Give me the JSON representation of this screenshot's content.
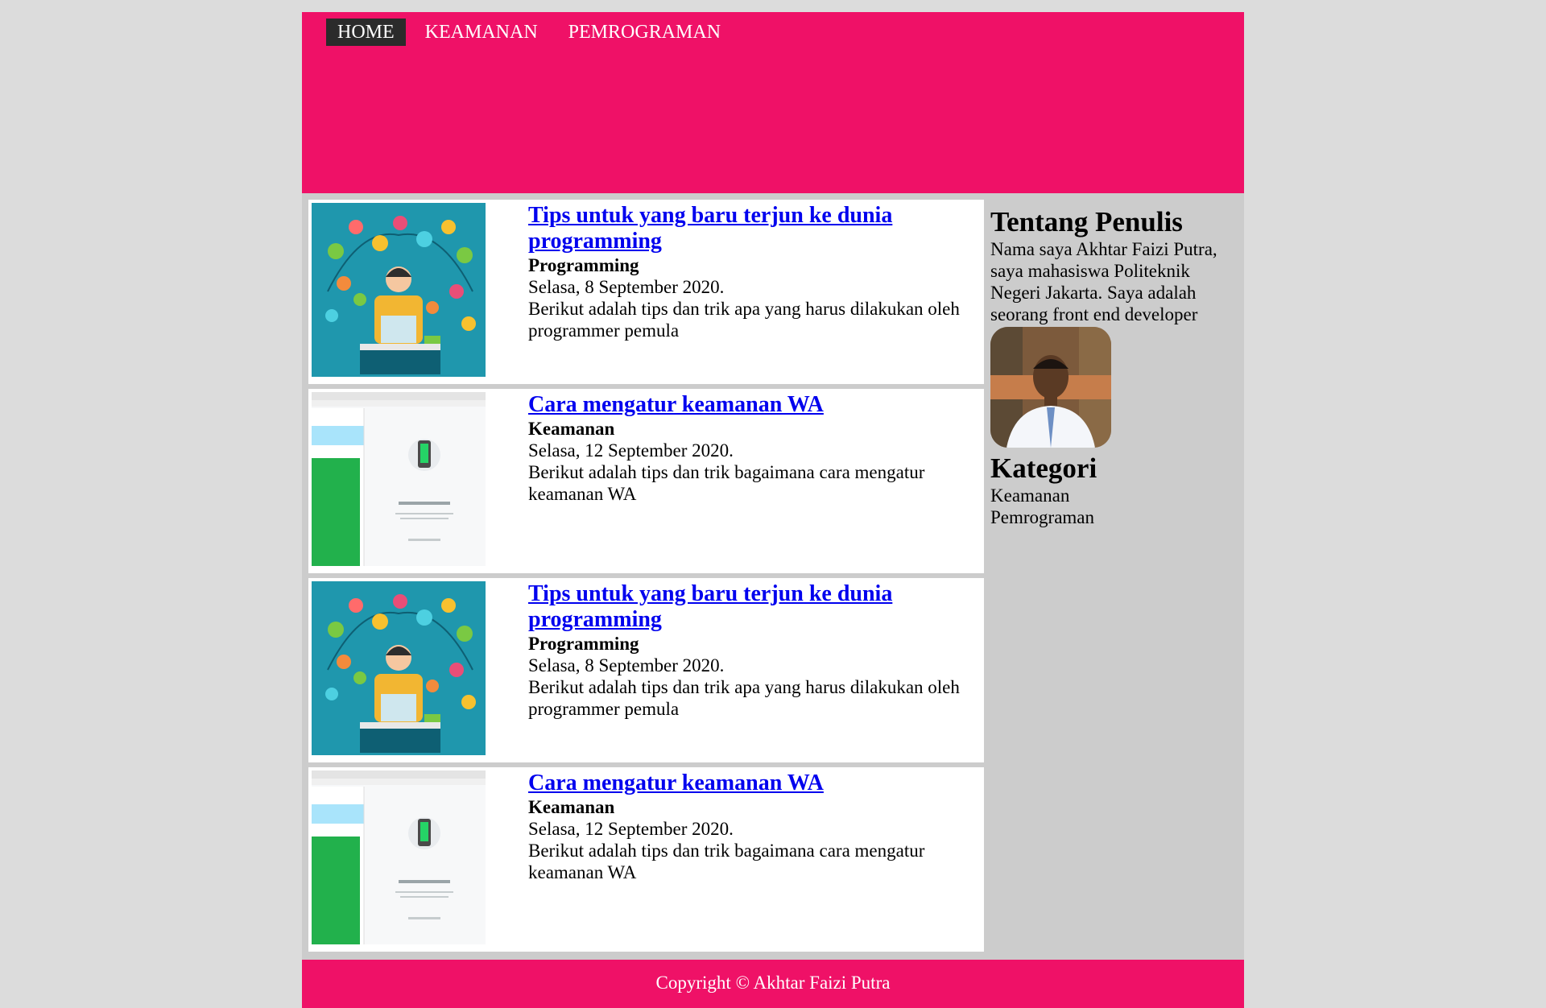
{
  "nav": {
    "items": [
      {
        "label": "HOME"
      },
      {
        "label": "KEAMANAN"
      },
      {
        "label": "PEMROGRAMAN"
      }
    ]
  },
  "posts": [
    {
      "title": "Tips untuk yang baru terjun ke dunia programming",
      "category": "Programming",
      "date": "Selasa, 8 September 2020.",
      "desc": "Berikut adalah tips dan trik apa yang harus dilakukan oleh programmer pemula",
      "thumb": "programming-illustration"
    },
    {
      "title": "Cara mengatur keamanan WA",
      "category": "Keamanan",
      "date": "Selasa, 12 September 2020.",
      "desc": "Berikut adalah tips dan trik bagaimana cara mengatur keamanan WA",
      "thumb": "whatsapp-web-screenshot"
    },
    {
      "title": "Tips untuk yang baru terjun ke dunia programming",
      "category": "Programming",
      "date": "Selasa, 8 September 2020.",
      "desc": "Berikut adalah tips dan trik apa yang harus dilakukan oleh programmer pemula",
      "thumb": "programming-illustration"
    },
    {
      "title": "Cara mengatur keamanan WA",
      "category": "Keamanan",
      "date": "Selasa, 12 September 2020.",
      "desc": "Berikut adalah tips dan trik bagaimana cara mengatur keamanan WA",
      "thumb": "whatsapp-web-screenshot"
    }
  ],
  "aside": {
    "about_title": "Tentang Penulis",
    "about_text": "Nama saya Akhtar Faizi Putra, saya mahasiswa Politeknik Negeri Jakarta. Saya adalah seorang front end developer",
    "category_title": "Kategori",
    "categories": [
      "Keamanan",
      "Pemrograman"
    ]
  },
  "footer": {
    "text": "Copyright © Akhtar Faizi Putra"
  },
  "colors": {
    "header": "#ef1167",
    "nav_active": "#2b2b2b",
    "link": "#0000ee",
    "main_bg": "#cccccc",
    "page_bg": "#dcdcdc"
  }
}
